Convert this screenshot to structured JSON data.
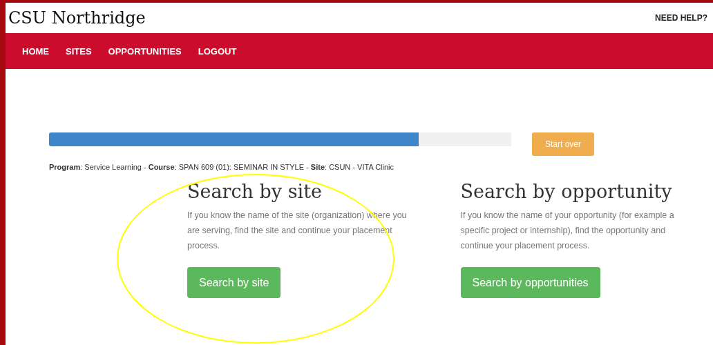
{
  "header": {
    "title": "CSU Northridge",
    "help_link": "NEED HELP?"
  },
  "nav": [
    {
      "label": "HOME"
    },
    {
      "label": "SITES"
    },
    {
      "label": "OPPORTUNITIES"
    },
    {
      "label": "LOGOUT"
    }
  ],
  "progress": {
    "level": 0.8
  },
  "start_over_button": "Start over",
  "info_line": "**Program**: Service Learning - **Course**: SPAN 609 (01): SEMINAR IN STYLE - **Site**: CSUN - VITA Clinic",
  "options": [
    {
      "heading": "Search by site",
      "description_lines": [
        "If you know the name of the site (organization) where you",
        "are serving, find the site and continue your placement",
        "process."
      ],
      "button": "Search by site",
      "highlighted": true
    },
    {
      "heading": "Search by opportunity",
      "description_lines": [
        "If you know the name of your opportunity (for example a",
        "specific project or internship), find the opportunity and",
        "continue your placement process."
      ],
      "button": "Search by opportunities",
      "highlighted": false
    }
  ]
}
